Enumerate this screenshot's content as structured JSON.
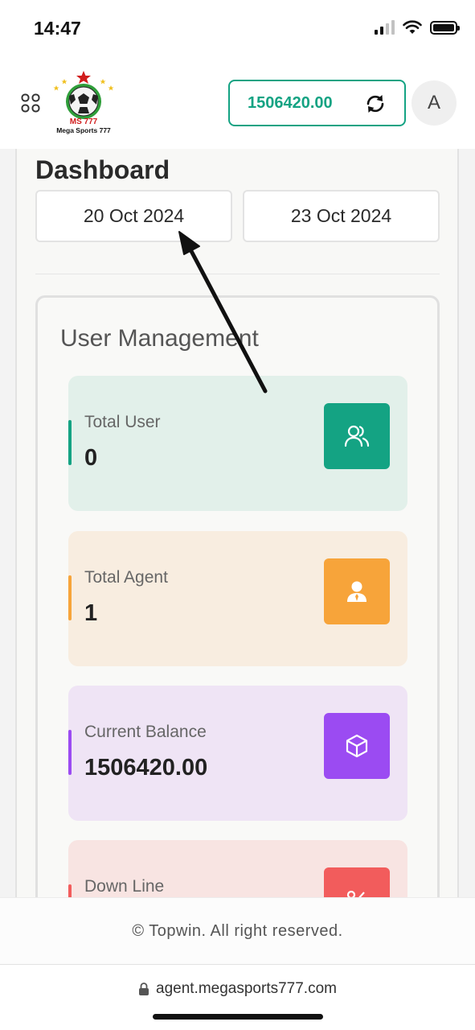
{
  "status_bar": {
    "time": "14:47"
  },
  "header": {
    "logo": {
      "title": "MS 777",
      "subtitle": "Mega Sports 777"
    },
    "balance": "1506420.00",
    "avatar_letter": "A"
  },
  "dashboard": {
    "title": "Dashboard",
    "date_from": "20 Oct 2024",
    "date_to": "23 Oct 2024"
  },
  "user_management": {
    "title": "User Management",
    "cards": [
      {
        "label": "Total User",
        "value": "0",
        "icon": "users-icon",
        "bg": "#e2f0ea",
        "accent": "#14a383"
      },
      {
        "label": "Total Agent",
        "value": "1",
        "icon": "agent-icon",
        "bg": "#f8ede0",
        "accent": "#f7a43a"
      },
      {
        "label": "Current Balance",
        "value": "1506420.00",
        "icon": "box-icon",
        "bg": "#efe4f5",
        "accent": "#9b4bf2"
      },
      {
        "label": "Down Line",
        "value": "",
        "icon": "percent-icon",
        "bg": "#f8e4e2",
        "accent": "#f25c5c"
      }
    ]
  },
  "footer": {
    "copyright": "© Topwin. All right reserved."
  },
  "browser": {
    "url": "agent.megasports777.com"
  },
  "colors": {
    "brand": "#14a383",
    "annotation_arrow": "#111111"
  }
}
